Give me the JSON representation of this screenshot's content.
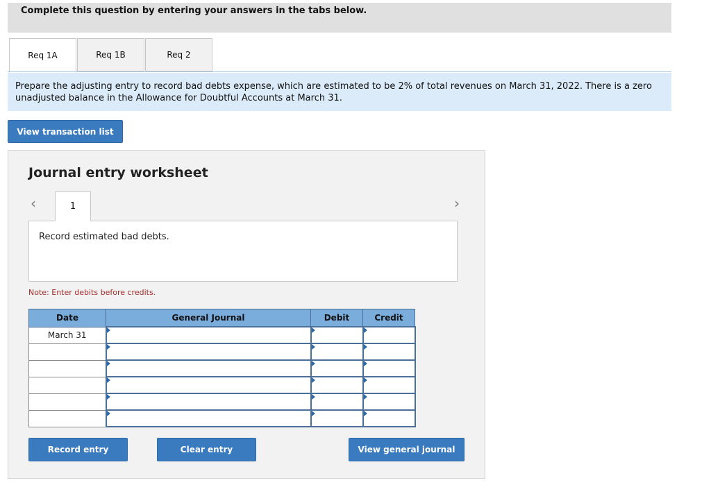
{
  "banner": {
    "text": "Complete this question by entering your answers in the tabs below."
  },
  "tabs": [
    {
      "label": "Req 1A",
      "active": true
    },
    {
      "label": "Req 1B",
      "active": false
    },
    {
      "label": "Req 2",
      "active": false
    }
  ],
  "instructions": {
    "text": "Prepare the adjusting entry to record bad debts expense, which are estimated to be 2% of total revenues on March 31, 2022. There is a zero unadjusted balance in the Allowance for Doubtful Accounts at March 31."
  },
  "buttons": {
    "view_transaction_list": "View transaction list",
    "record_entry": "Record entry",
    "clear_entry": "Clear entry",
    "view_general_journal": "View general journal"
  },
  "worksheet": {
    "title": "Journal entry worksheet",
    "entry_number": "1",
    "prev_icon": "chevron-left-icon",
    "next_icon": "chevron-right-icon",
    "description": "Record estimated bad debts.",
    "note": "Note: Enter debits before credits."
  },
  "journal_table": {
    "headers": {
      "date": "Date",
      "general_journal": "General Journal",
      "debit": "Debit",
      "credit": "Credit"
    },
    "rows": [
      {
        "date": "March 31",
        "account": "",
        "debit": "",
        "credit": ""
      },
      {
        "date": "",
        "account": "",
        "debit": "",
        "credit": ""
      },
      {
        "date": "",
        "account": "",
        "debit": "",
        "credit": ""
      },
      {
        "date": "",
        "account": "",
        "debit": "",
        "credit": ""
      },
      {
        "date": "",
        "account": "",
        "debit": "",
        "credit": ""
      },
      {
        "date": "",
        "account": "",
        "debit": "",
        "credit": ""
      }
    ]
  },
  "colors": {
    "primary_button": "#3a7bc0",
    "table_header": "#7aacdc",
    "instruction_bg": "#dcebf9",
    "note_text": "#a52a2a"
  }
}
